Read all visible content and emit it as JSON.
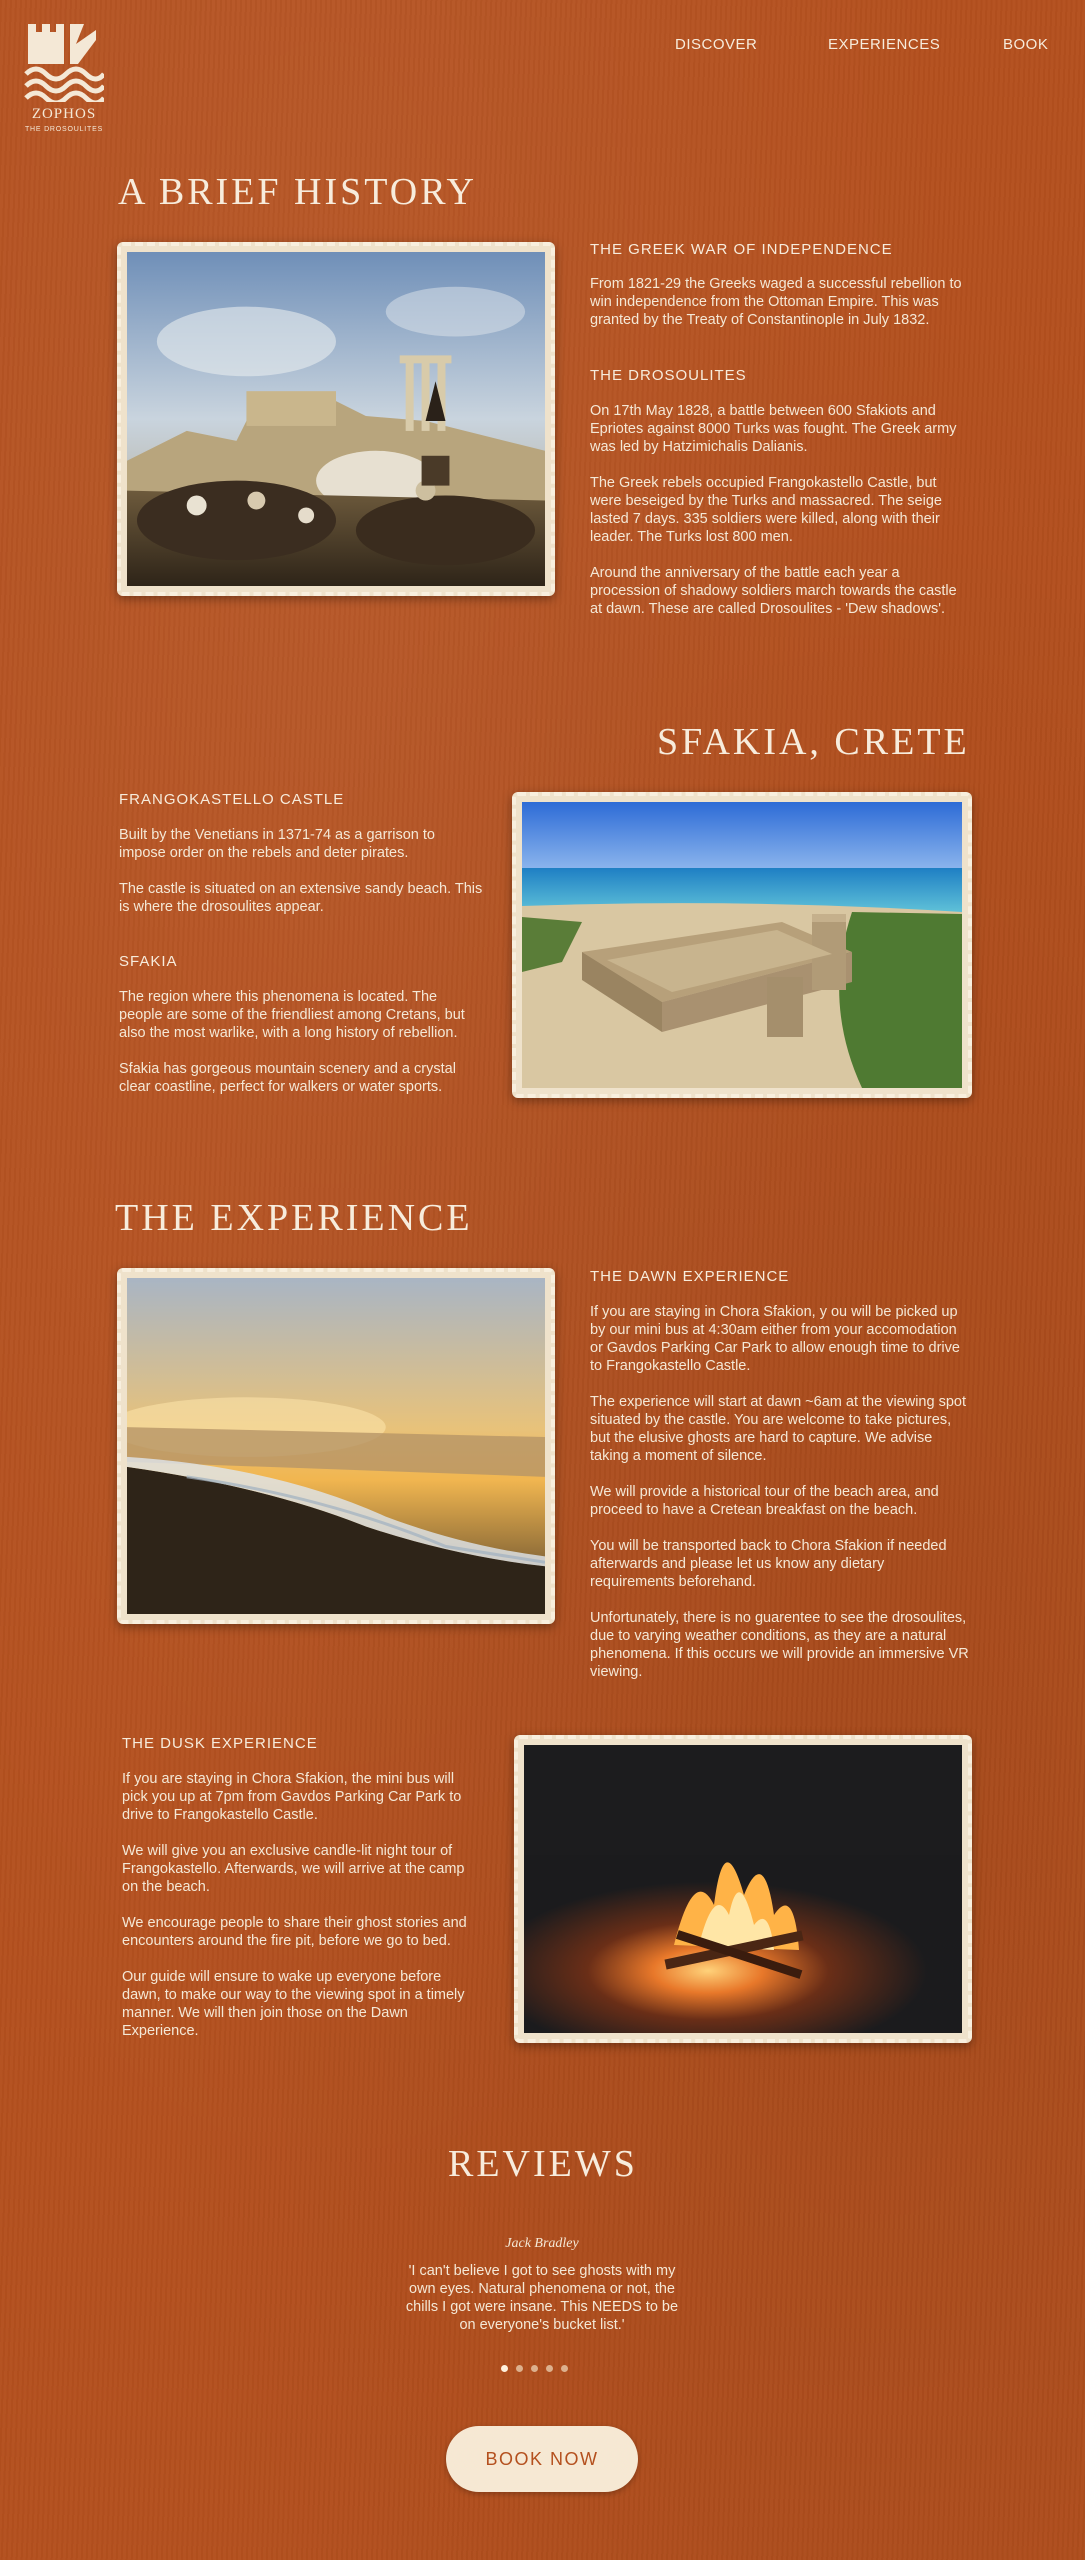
{
  "brand": {
    "name": "ZOPHOS",
    "tagline": "THE DROSOULITES",
    "color": "#b4501e"
  },
  "nav": {
    "discover": "DISCOVER",
    "experiences": "EXPERIENCES",
    "book": "BOOK"
  },
  "history": {
    "title": "A BRIEF HISTORY",
    "war_heading": "THE GREEK WAR OF INDEPENDENCE",
    "war_text": "From 1821-29 the Greeks waged a successful rebellion to win independence from the Ottoman Empire. This was granted by the Treaty of Constantinople in July 1832.",
    "dros_heading": "THE DROSOULITES",
    "dros_p1": "On 17th May 1828, a battle between 600 Sfakiots and Epriotes against 8000 Turks was fought. The Greek army was led by Hatzimichalis Dalianis.",
    "dros_p2": "The Greek rebels occupied Frangokastello Castle, but were beseiged by the Turks and massacred. The seige lasted 7 days. 335 soldiers were killed, along with their leader. The Turks lost 800 men.",
    "dros_p3": "Around the anniversary of the battle each year a procession of shadowy soldiers march towards the castle at dawn. These are called Drosoulites - 'Dew shadows'."
  },
  "sfakia": {
    "title": "SFAKIA, CRETE",
    "castle_heading": "FRANGOKASTELLO CASTLE",
    "castle_p1": "Built by the Venetians in 1371-74 as a garrison to impose order on the rebels and deter pirates.",
    "castle_p2": "The castle is situated on an extensive sandy beach. This is where the drosoulites appear.",
    "sfakia_heading": "SFAKIA",
    "sfakia_p1": "The region where this phenomena is located. The people are some of the friendliest among Cretans, but also the most warlike, with a long history of rebellion.",
    "sfakia_p2": "Sfakia has gorgeous mountain scenery and a crystal clear coastline, perfect for walkers or water sports."
  },
  "experience": {
    "title": "THE EXPERIENCE",
    "dawn_heading": "THE DAWN EXPERIENCE",
    "dawn_p1": "If you are staying in Chora Sfakion, y ou will be picked up by our mini bus at 4:30am either from your accomodation or Gavdos Parking Car Park to allow enough time to drive to Frangokastello Castle.",
    "dawn_p2": "The experience will start at dawn ~6am at the viewing spot situated by the castle. You are welcome to take pictures, but the elusive ghosts are hard to capture. We advise taking a moment of silence.",
    "dawn_p3": "We will provide a historical tour of the beach area, and proceed to have a Cretean breakfast on the beach.",
    "dawn_p4": "You will be transported back to Chora Sfakion if needed afterwards and please let us know any dietary requirements beforehand.",
    "dawn_p5": "Unfortunately, there is no guarentee to see the drosoulites, due to varying weather conditions, as they are a natural phenomena. If this occurs we will provide an immersive VR viewing.",
    "dusk_heading": "THE DUSK EXPERIENCE",
    "dusk_p1": "If you are staying in Chora Sfakion, the mini bus will pick you up at 7pm from Gavdos Parking Car Park to drive to Frangokastello Castle.",
    "dusk_p2": "We will give you an exclusive candle-lit night tour of Frangokastello. Afterwards, we will arrive at the camp on the beach.",
    "dusk_p3": "We encourage people to share their ghost stories and encounters around the fire pit, before we go to bed.",
    "dusk_p4": "Our guide will ensure to wake up everyone before dawn, to make our way to the viewing spot in a timely manner. We will then join those on the Dawn Experience."
  },
  "reviews": {
    "title": "REVIEWS",
    "name": "Jack Bradley",
    "quote": "'I can't believe I got to see ghosts with my own eyes. Natural phenomena or not, the chills I got were insane. This NEEDS to be on everyone's bucket list.'",
    "dots_total": 5,
    "active_dot": 1
  },
  "cta": {
    "label": "BOOK NOW"
  }
}
